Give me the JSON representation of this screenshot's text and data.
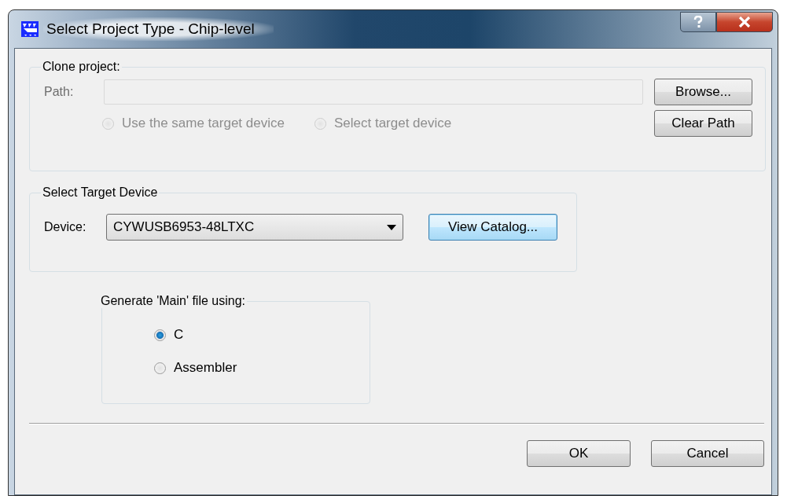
{
  "window": {
    "title": "Select Project Type - Chip-level"
  },
  "clone_project": {
    "legend": "Clone project:",
    "path": {
      "label": "Path:",
      "disabled": true
    },
    "radios": [
      {
        "label": "Use the same target device",
        "selected": false,
        "disabled": true
      },
      {
        "label": "Select target device",
        "selected": false,
        "disabled": true
      }
    ],
    "buttons": [
      {
        "label": "Browse..."
      },
      {
        "label": "Clear Path"
      }
    ]
  },
  "target_device": {
    "legend": "Select Target Device",
    "device": {
      "label": "Device:",
      "value": "CYWUSB6953-48LTXC"
    },
    "button": {
      "label": "View Catalog...",
      "focused": true
    }
  },
  "generate_main": {
    "legend": "Generate 'Main' file using:",
    "options": [
      {
        "label": "C",
        "selected": true
      },
      {
        "label": "Assembler",
        "selected": false
      }
    ]
  },
  "buttons": [
    {
      "label": "OK"
    },
    {
      "label": "Cancel"
    }
  ]
}
